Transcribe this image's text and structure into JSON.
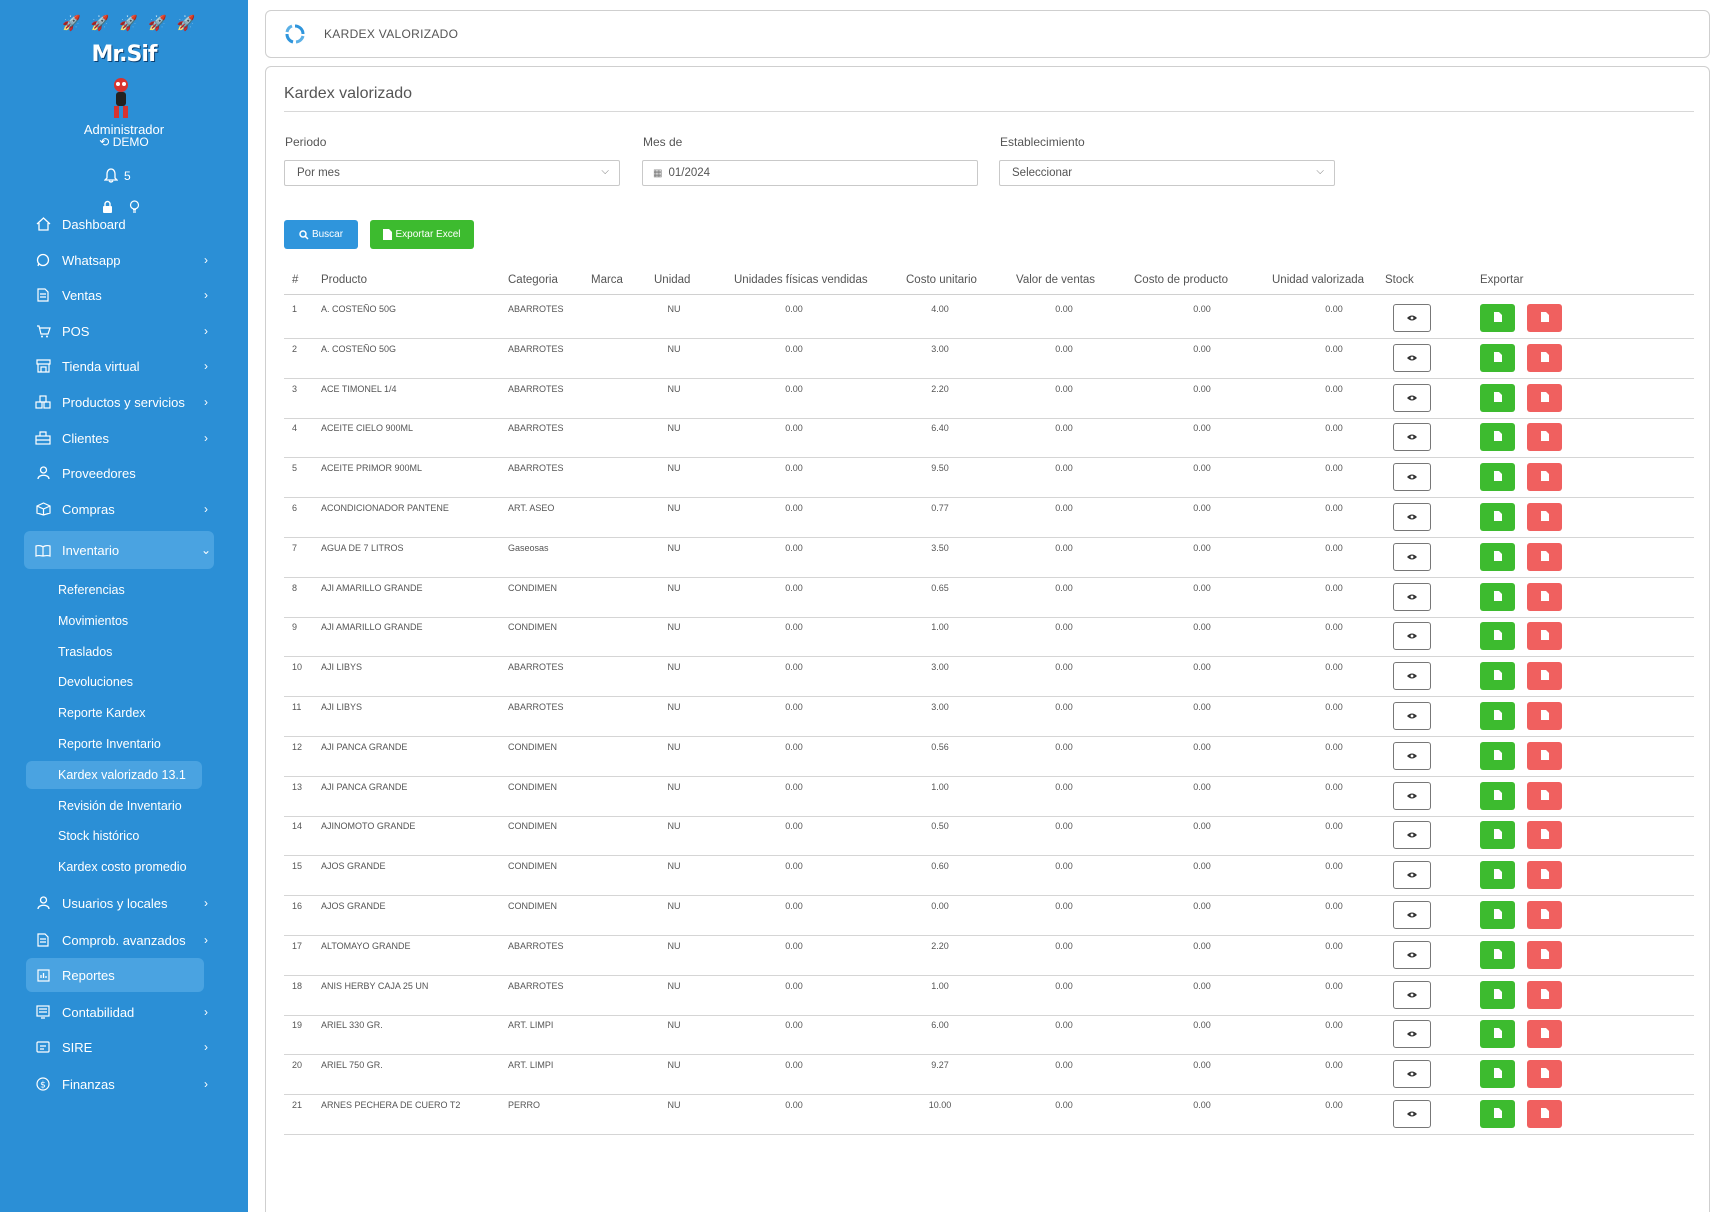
{
  "sidebar": {
    "brand": "Mr.Sif",
    "user_name": "Administrador",
    "user_company": "DEMO",
    "notifications_count": "5",
    "menu": [
      {
        "label": "Dashboard",
        "icon": "home-icon",
        "has_children": false
      },
      {
        "label": "Whatsapp",
        "icon": "whatsapp-icon",
        "has_children": true
      },
      {
        "label": "Ventas",
        "icon": "document-icon",
        "has_children": true
      },
      {
        "label": "POS",
        "icon": "cart-icon",
        "has_children": true
      },
      {
        "label": "Tienda virtual",
        "icon": "store-icon",
        "has_children": true
      },
      {
        "label": "Productos y servicios",
        "icon": "boxes-icon",
        "has_children": true
      },
      {
        "label": "Clientes",
        "icon": "users-icon",
        "has_children": true
      },
      {
        "label": "Proveedores",
        "icon": "user-icon",
        "has_children": false
      },
      {
        "label": "Compras",
        "icon": "package-icon",
        "has_children": true
      },
      {
        "label": "Inventario",
        "icon": "book-icon",
        "has_children": true,
        "expanded": true
      }
    ],
    "inventory_submenu": [
      "Referencias",
      "Movimientos",
      "Traslados",
      "Devoluciones",
      "Reporte Kardex",
      "Reporte Inventario",
      "Kardex valorizado 13.1",
      "Revisión de Inventario",
      "Stock histórico",
      "Kardex costo promedio"
    ],
    "active_submenu": "Kardex valorizado 13.1",
    "menu_bottom": [
      {
        "label": "Usuarios y locales",
        "icon": "user-icon",
        "has_children": true
      },
      {
        "label": "Comprob. avanzados",
        "icon": "document-icon",
        "has_children": true
      },
      {
        "label": "Reportes",
        "icon": "report-icon",
        "has_children": false
      },
      {
        "label": "Contabilidad",
        "icon": "accounting-icon",
        "has_children": true
      },
      {
        "label": "SIRE",
        "icon": "sire-icon",
        "has_children": true
      },
      {
        "label": "Finanzas",
        "icon": "dollar-icon",
        "has_children": true
      }
    ]
  },
  "header": {
    "title": "KARDEX VALORIZADO"
  },
  "card": {
    "title": "Kardex valorizado"
  },
  "filters": {
    "periodo_label": "Periodo",
    "periodo_value": "Por mes",
    "mes_label": "Mes de",
    "mes_value": "01/2024",
    "establecimiento_label": "Establecimiento",
    "establecimiento_value": "Seleccionar"
  },
  "buttons": {
    "search": "Buscar",
    "export_excel": "Exportar Excel"
  },
  "table": {
    "columns": [
      "#",
      "Producto",
      "Categoria",
      "Marca",
      "Unidad",
      "Unidades físicas vendidas",
      "Costo unitario",
      "Valor de ventas",
      "Costo de producto",
      "Unidad valorizada",
      "Stock",
      "Exportar"
    ],
    "rows": [
      [
        "1",
        "A. COSTEÑO 50G",
        "ABARROTES",
        "",
        "NU",
        "0.00",
        "4.00",
        "0.00",
        "0.00",
        "0.00"
      ],
      [
        "2",
        "A. COSTEÑO 50G",
        "ABARROTES",
        "",
        "NU",
        "0.00",
        "3.00",
        "0.00",
        "0.00",
        "0.00"
      ],
      [
        "3",
        "ACE TIMONEL 1/4",
        "ABARROTES",
        "",
        "NU",
        "0.00",
        "2.20",
        "0.00",
        "0.00",
        "0.00"
      ],
      [
        "4",
        "ACEITE CIELO 900ML",
        "ABARROTES",
        "",
        "NU",
        "0.00",
        "6.40",
        "0.00",
        "0.00",
        "0.00"
      ],
      [
        "5",
        "ACEITE PRIMOR 900ML",
        "ABARROTES",
        "",
        "NU",
        "0.00",
        "9.50",
        "0.00",
        "0.00",
        "0.00"
      ],
      [
        "6",
        "ACONDICIONADOR PANTENE",
        "ART. ASEO",
        "",
        "NU",
        "0.00",
        "0.77",
        "0.00",
        "0.00",
        "0.00"
      ],
      [
        "7",
        "AGUA DE 7 LITROS",
        "Gaseosas",
        "",
        "NU",
        "0.00",
        "3.50",
        "0.00",
        "0.00",
        "0.00"
      ],
      [
        "8",
        "AJI AMARILLO GRANDE",
        "CONDIMEN",
        "",
        "NU",
        "0.00",
        "0.65",
        "0.00",
        "0.00",
        "0.00"
      ],
      [
        "9",
        "AJI AMARILLO GRANDE",
        "CONDIMEN",
        "",
        "NU",
        "0.00",
        "1.00",
        "0.00",
        "0.00",
        "0.00"
      ],
      [
        "10",
        "AJI LIBYS",
        "ABARROTES",
        "",
        "NU",
        "0.00",
        "3.00",
        "0.00",
        "0.00",
        "0.00"
      ],
      [
        "11",
        "AJI LIBYS",
        "ABARROTES",
        "",
        "NU",
        "0.00",
        "3.00",
        "0.00",
        "0.00",
        "0.00"
      ],
      [
        "12",
        "AJI PANCA GRANDE",
        "CONDIMEN",
        "",
        "NU",
        "0.00",
        "0.56",
        "0.00",
        "0.00",
        "0.00"
      ],
      [
        "13",
        "AJI PANCA GRANDE",
        "CONDIMEN",
        "",
        "NU",
        "0.00",
        "1.00",
        "0.00",
        "0.00",
        "0.00"
      ],
      [
        "14",
        "AJINOMOTO GRANDE",
        "CONDIMEN",
        "",
        "NU",
        "0.00",
        "0.50",
        "0.00",
        "0.00",
        "0.00"
      ],
      [
        "15",
        "AJOS GRANDE",
        "CONDIMEN",
        "",
        "NU",
        "0.00",
        "0.60",
        "0.00",
        "0.00",
        "0.00"
      ],
      [
        "16",
        "AJOS GRANDE",
        "CONDIMEN",
        "",
        "NU",
        "0.00",
        "0.00",
        "0.00",
        "0.00",
        "0.00"
      ],
      [
        "17",
        "ALTOMAYO GRANDE",
        "ABARROTES",
        "",
        "NU",
        "0.00",
        "2.20",
        "0.00",
        "0.00",
        "0.00"
      ],
      [
        "18",
        "ANIS HERBY CAJA 25 UN",
        "ABARROTES",
        "",
        "NU",
        "0.00",
        "1.00",
        "0.00",
        "0.00",
        "0.00"
      ],
      [
        "19",
        "ARIEL 330 GR.",
        "ART. LIMPI",
        "",
        "NU",
        "0.00",
        "6.00",
        "0.00",
        "0.00",
        "0.00"
      ],
      [
        "20",
        "ARIEL 750 GR.",
        "ART. LIMPI",
        "",
        "NU",
        "0.00",
        "9.27",
        "0.00",
        "0.00",
        "0.00"
      ],
      [
        "21",
        "ARNES PECHERA DE CUERO T2",
        "PERRO",
        "",
        "NU",
        "0.00",
        "10.00",
        "0.00",
        "0.00",
        "0.00"
      ]
    ]
  },
  "colors": {
    "sidebar": "#2b8fd6",
    "primary": "#2f95dc",
    "success": "#3dbb2f",
    "danger": "#f0605f"
  }
}
